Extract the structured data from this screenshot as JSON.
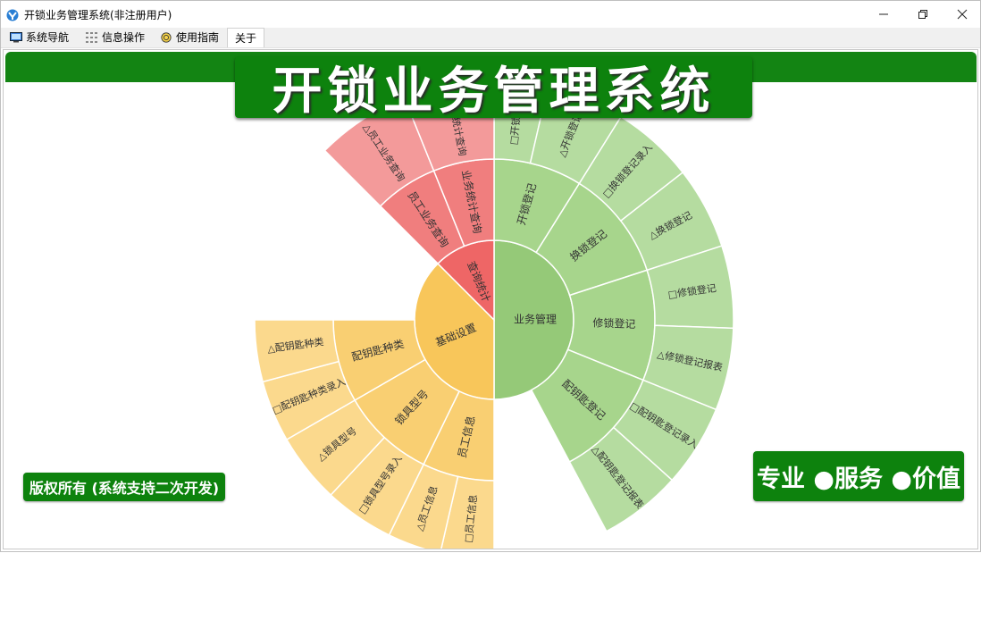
{
  "window": {
    "title": "开锁业务管理系统(非注册用户)"
  },
  "menu": {
    "items": [
      {
        "label": "系统导航",
        "icon": "monitor-icon"
      },
      {
        "label": "信息操作",
        "icon": "grid-icon"
      },
      {
        "label": "使用指南",
        "icon": "help-icon"
      },
      {
        "label": "关于",
        "icon": ""
      }
    ]
  },
  "main": {
    "title": "开锁业务管理系统",
    "copyright": "版权所有 (系统支持二次开发)",
    "slogan": "专业 ●服务 ●价值"
  },
  "colors": {
    "brand_green": "#0d820d",
    "biz": "#95c978",
    "biz_outer": "#b5dca0",
    "base": "#f8c65a",
    "base_outer": "#fbd98d",
    "query": "#ee6666",
    "query_outer": "#f39a9a"
  },
  "sunburst": {
    "center": [
      {
        "label": "业务管理",
        "color": "#95c978",
        "start": 0,
        "end": 180
      },
      {
        "label": "基础设置",
        "color": "#f8c65a",
        "start": 180,
        "end": 315
      },
      {
        "label": "查询统计",
        "color": "#ee6666",
        "start": 315,
        "end": 360
      }
    ],
    "ring1": [
      {
        "label": "开锁登记",
        "color": "#a7d58c",
        "start": 0,
        "end": 32
      },
      {
        "label": "换锁登记",
        "color": "#a7d58c",
        "start": 32,
        "end": 72
      },
      {
        "label": "修锁登记",
        "color": "#a7d58c",
        "start": 72,
        "end": 112
      },
      {
        "label": "配钥匙登记",
        "color": "#a7d58c",
        "start": 112,
        "end": 152
      },
      {
        "label": "员工信息",
        "color": "#f9cf72",
        "start": 180,
        "end": 206
      },
      {
        "label": "锁具型号",
        "color": "#f9cf72",
        "start": 206,
        "end": 240
      },
      {
        "label": "配钥匙种类",
        "color": "#f9cf72",
        "start": 240,
        "end": 270
      },
      {
        "label": "员工业务查询",
        "color": "#f07e7e",
        "start": 315,
        "end": 338
      },
      {
        "label": "业务统计查询",
        "color": "#f07e7e",
        "start": 338,
        "end": 360
      }
    ],
    "ring2": [
      {
        "label": "□开锁登...",
        "color": "#b5dca0",
        "start": 0,
        "end": 13
      },
      {
        "label": "△开锁登记",
        "color": "#b5dca0",
        "start": 13,
        "end": 32
      },
      {
        "label": "□换锁登记录入",
        "color": "#b5dca0",
        "start": 32,
        "end": 52
      },
      {
        "label": "△换锁登记",
        "color": "#b5dca0",
        "start": 52,
        "end": 72
      },
      {
        "label": "□修锁登记",
        "color": "#b5dca0",
        "start": 72,
        "end": 92
      },
      {
        "label": "△修锁登记报表",
        "color": "#b5dca0",
        "start": 92,
        "end": 112
      },
      {
        "label": "□配钥匙登记录入",
        "color": "#b5dca0",
        "start": 112,
        "end": 132
      },
      {
        "label": "△配钥匙登记报表",
        "color": "#b5dca0",
        "start": 132,
        "end": 152
      },
      {
        "label": "□员工信息",
        "color": "#fbd98d",
        "start": 180,
        "end": 193
      },
      {
        "label": "△员工信息",
        "color": "#fbd98d",
        "start": 193,
        "end": 206
      },
      {
        "label": "□锁具型号录入",
        "color": "#fbd98d",
        "start": 206,
        "end": 223
      },
      {
        "label": "△锁具型号",
        "color": "#fbd98d",
        "start": 223,
        "end": 240
      },
      {
        "label": "□配钥匙种类录入",
        "color": "#fbd98d",
        "start": 240,
        "end": 255
      },
      {
        "label": "△配钥匙种类",
        "color": "#fbd98d",
        "start": 255,
        "end": 270
      },
      {
        "label": "△员工业务查询",
        "color": "#f39a9a",
        "start": 315,
        "end": 338
      },
      {
        "label": "△业务统计查询",
        "color": "#f39a9a",
        "start": 338,
        "end": 360
      }
    ]
  }
}
